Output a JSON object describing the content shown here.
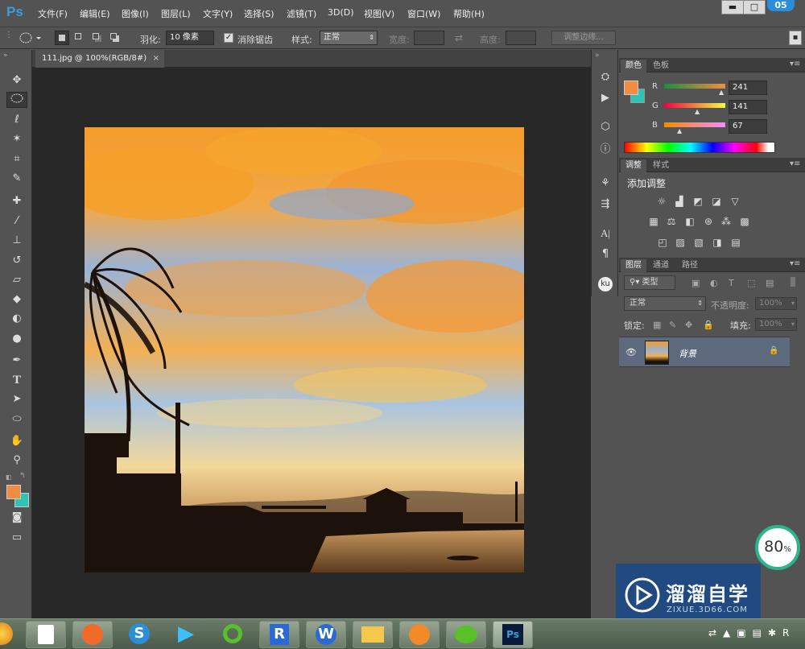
{
  "app": {
    "logo": "Ps"
  },
  "menu": [
    "文件(F)",
    "编辑(E)",
    "图像(I)",
    "图层(L)",
    "文字(Y)",
    "选择(S)",
    "滤镜(T)",
    "3D(D)",
    "视图(V)",
    "窗口(W)",
    "帮助(H)"
  ],
  "window_controls": {
    "minimize": "▬",
    "maximize": "□",
    "badge": "05"
  },
  "options": {
    "feather_label": "羽化:",
    "feather_value": "10 像素",
    "antialias_label": "消除锯齿",
    "antialias_checked": true,
    "style_label": "样式:",
    "style_value": "正常",
    "width_label": "宽度:",
    "height_label": "高度:",
    "refine_edge": "调整边缘..."
  },
  "document": {
    "tab_title": "111.jpg @ 100%(RGB/8#)",
    "close": "×"
  },
  "color_panel": {
    "tabs": [
      "颜色",
      "色板"
    ],
    "r_label": "R",
    "g_label": "G",
    "b_label": "B",
    "r": "241",
    "g": "141",
    "b": "67",
    "foreground": "#f18d43",
    "background": "#2ec3b4"
  },
  "adjust_panel": {
    "tabs": [
      "调整",
      "样式"
    ],
    "add_label": "添加调整"
  },
  "layers_panel": {
    "tabs": [
      "图层",
      "通道",
      "路径"
    ],
    "filter_kind": "类型",
    "blend_mode": "正常",
    "opacity_label": "不透明度:",
    "opacity_value": "100%",
    "lock_label": "锁定:",
    "fill_label": "填充:",
    "fill_value": "100%",
    "layer_name": "背景"
  },
  "gauge": {
    "value": "80",
    "unit": "%"
  },
  "watermark": {
    "title": "溜溜自学",
    "url": "ZIXUE.3D66.COM"
  },
  "colors": {
    "panel_bg": "#535353",
    "canvas_bg": "#282828",
    "accent": "#3a9fd8"
  }
}
